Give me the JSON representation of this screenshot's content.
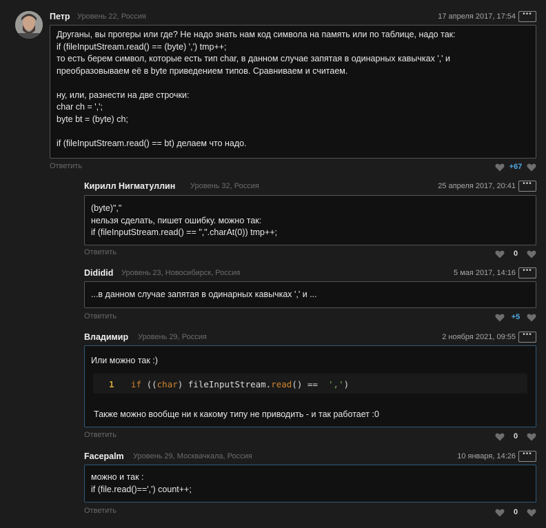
{
  "comments": [
    {
      "author": "Петр",
      "meta": "Уровень 22, Россия",
      "date": "17 апреля 2017, 17:54",
      "lines": [
        "Друганы, вы прогеры или где? Не надо знать нам код символа на память или по таблице, надо так:",
        "if (fileInputStream.read() == (byte) ',') tmp++;",
        "то есть берем символ, которые есть тип char, в данном случае запятая в одинарных кавычках ',' и",
        "преобразовываем её в byte приведением типов. Сравниваем и считаем.",
        "",
        "ну, или, разнести на две строчки:",
        "char ch = ',';",
        "byte bt = (byte) ch;",
        "",
        "if (fileInputStream.read() == bt) делаем что надо."
      ],
      "reply": "Ответить",
      "votes": "+67"
    },
    {
      "author": "Кирилл Нигматуллин",
      "meta": "Уровень 32, Россия",
      "date": "25 апреля 2017, 20:41",
      "lines": [
        "(byte)\",\"",
        "нельзя сделать, пишет ошибку. можно так:",
        "if (fileInputStream.read() == \",\".charAt(0)) tmp++;"
      ],
      "reply": "Ответить",
      "votes": "0"
    },
    {
      "author": "Dididid",
      "meta": "Уровень 23, Новосибирск, Россия",
      "date": "5 мая 2017, 14:16",
      "lines": [
        "...в данном случае запятая в одинарных кавычках ',' и ..."
      ],
      "reply": "Ответить",
      "votes": "+5"
    },
    {
      "author": "Владимир",
      "meta": "Уровень 29, Россия",
      "date": "2 ноября 2021, 09:55",
      "intro": "Или можно так :)",
      "code_line_number": "1",
      "code_parts": {
        "kw_if": "if",
        "p1": " ((",
        "kw_char": "char",
        "p2": ") fileInputStream.",
        "kw_read": "read",
        "p3": "() ==  ",
        "str": "','",
        "p4": ")"
      },
      "outro": "Также можно вообще ни к какому типу не приводить - и так работает :0",
      "reply": "Ответить",
      "votes": "0"
    },
    {
      "author": "Facepalm",
      "meta": "Уровень 29, Москвачкала, Россия",
      "date": "10 января, 14:26",
      "lines": [
        "можно и так :",
        "if (file.read()==',') count++;"
      ],
      "reply": "Ответить",
      "votes": "0"
    }
  ],
  "more_label": "•••",
  "colors": {
    "accent_positive": "#4fa8e0",
    "border_blue": "#2f5a7a"
  }
}
